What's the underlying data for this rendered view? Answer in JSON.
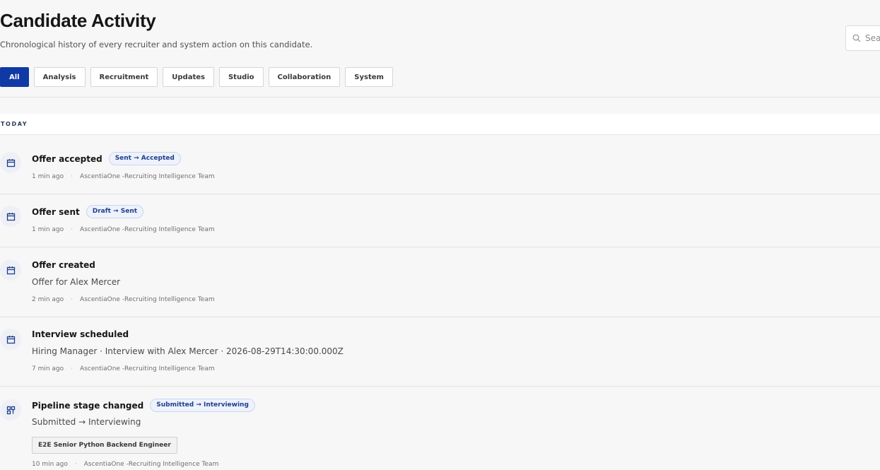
{
  "header": {
    "title": "Candidate Activity",
    "subtitle": "Chronological history of every recruiter and system action on this candidate."
  },
  "search": {
    "placeholder": "Search"
  },
  "tabs": [
    {
      "label": "All",
      "active": true
    },
    {
      "label": "Analysis"
    },
    {
      "label": "Recruitment"
    },
    {
      "label": "Updates"
    },
    {
      "label": "Studio"
    },
    {
      "label": "Collaboration"
    },
    {
      "label": "System"
    }
  ],
  "section": {
    "label": "TODAY"
  },
  "activities": [
    {
      "title": "Offer accepted",
      "pill": "Sent → Accepted",
      "icon": "calendar-icon",
      "time": "1 min ago",
      "separator": "·",
      "actor": "AscentiaOne -Recruiting Intelligence Team"
    },
    {
      "title": "Offer sent",
      "pill": "Draft → Sent",
      "icon": "calendar-icon",
      "time": "1 min ago",
      "separator": "·",
      "actor": "AscentiaOne -Recruiting Intelligence Team"
    },
    {
      "title": "Offer created",
      "detail": "Offer for Alex Mercer",
      "icon": "calendar-icon",
      "time": "2 min ago",
      "separator": "·",
      "actor": "AscentiaOne -Recruiting Intelligence Team"
    },
    {
      "title": "Interview scheduled",
      "detail": "Hiring Manager · Interview with Alex Mercer · 2026-08-29T14:30:00.000Z",
      "icon": "calendar-icon",
      "time": "7 min ago",
      "separator": "·",
      "actor": "AscentiaOne -Recruiting Intelligence Team"
    },
    {
      "title": "Pipeline stage changed",
      "pill": "Submitted → Interviewing",
      "detail": "Submitted → Interviewing",
      "tag": "E2E Senior Python Backend Engineer",
      "icon": "pipeline-icon",
      "time": "10 min ago",
      "separator": "·",
      "actor": "AscentiaOne -Recruiting Intelligence Team"
    }
  ],
  "colors": {
    "accent": "#0f3aa6",
    "pill_text": "#1d3f8f",
    "pill_bg": "#eef2fb",
    "background": "#f7f7f8"
  }
}
